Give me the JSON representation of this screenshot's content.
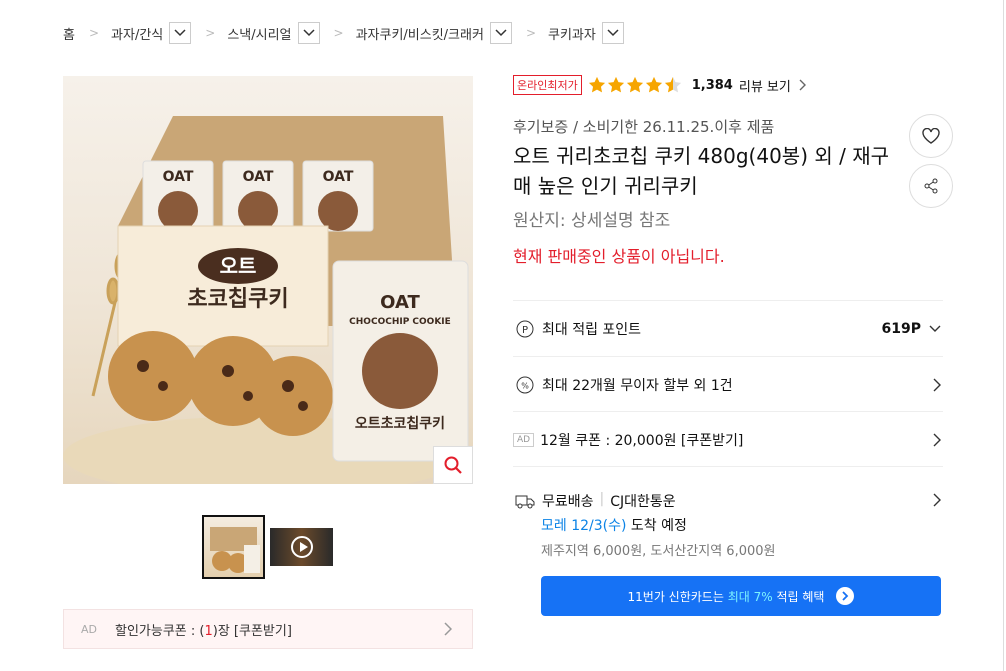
{
  "breadcrumb": [
    {
      "label": "홈"
    },
    {
      "label": "과자/간식"
    },
    {
      "label": "스낵/시리얼"
    },
    {
      "label": "과자쿠키/비스킷/크래커"
    },
    {
      "label": "쿠키과자"
    }
  ],
  "product_image": {
    "box_brand": "오트",
    "box_sub": "초코칩쿠키",
    "pack_label": "OAT",
    "pack_label2": "CHOCOCHIP COOKIE",
    "pack_name": "오트초코칩쿠키"
  },
  "rating": {
    "badge": "온라인최저가",
    "stars": 4.5,
    "count": "1,384",
    "review_label": "리뷰 보기"
  },
  "product": {
    "subtitle": "후기보증 / 소비기한 26.11.25.이후 제품",
    "title": "오트 귀리초코칩 쿠키 480g(40봉) 외 / 재구매 높은 인기 귀리쿠키",
    "origin": "원산지:  상세설명 참조",
    "status": "현재 판매중인 상품이 아닙니다."
  },
  "info": {
    "point_label": "최대 적립 포인트",
    "point_value": "619P",
    "installment": "최대 22개월 무이자 할부 외 1건",
    "ad_tag": "AD",
    "coupon": "12월 쿠폰 : 20,000원 [쿠폰받기]",
    "shipping_free": "무료배송",
    "shipping_carrier": "CJ대한통운",
    "delivery_date": "모레 12/3(수)",
    "delivery_suffix": "도착 예정",
    "delivery_extra": "제주지역 6,000원, 도서산간지역 6,000원"
  },
  "card_banner": {
    "prefix": "11번가 신한카드는",
    "highlight": "최대 7%",
    "suffix": "적립 혜택"
  },
  "coupon_bar": {
    "ad": "AD",
    "text_prefix": "할인가능쿠폰 : (",
    "count": "1",
    "text_suffix": ")장 [쿠폰받기]"
  },
  "colors": {
    "accent_red": "#e31e2b",
    "accent_blue": "#1672f5",
    "star": "#f6a500"
  }
}
